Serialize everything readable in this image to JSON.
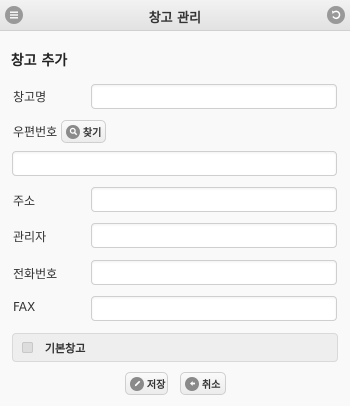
{
  "header": {
    "title": "창고 관리",
    "left_icon": "menu-icon",
    "right_icon": "back-icon"
  },
  "page_title": "창고 추가",
  "form": {
    "warehouse_name_label": "창고명",
    "warehouse_name_value": "",
    "postal_code_label": "우편번호",
    "find_button_label": "찾기",
    "postal_code_value": "",
    "address_label": "주소",
    "address_value": "",
    "manager_label": "관리자",
    "manager_value": "",
    "phone_label": "전화번호",
    "phone_value": "",
    "fax_label": "FAX",
    "fax_value": "",
    "default_warehouse_label": "기본창고",
    "default_warehouse_checked": false
  },
  "actions": {
    "save_label": "저장",
    "cancel_label": "취소"
  },
  "colors": {
    "icon_gray": "#8a8a8a",
    "header_bg": "#e8e8e8",
    "page_bg": "#f9f9f9"
  }
}
